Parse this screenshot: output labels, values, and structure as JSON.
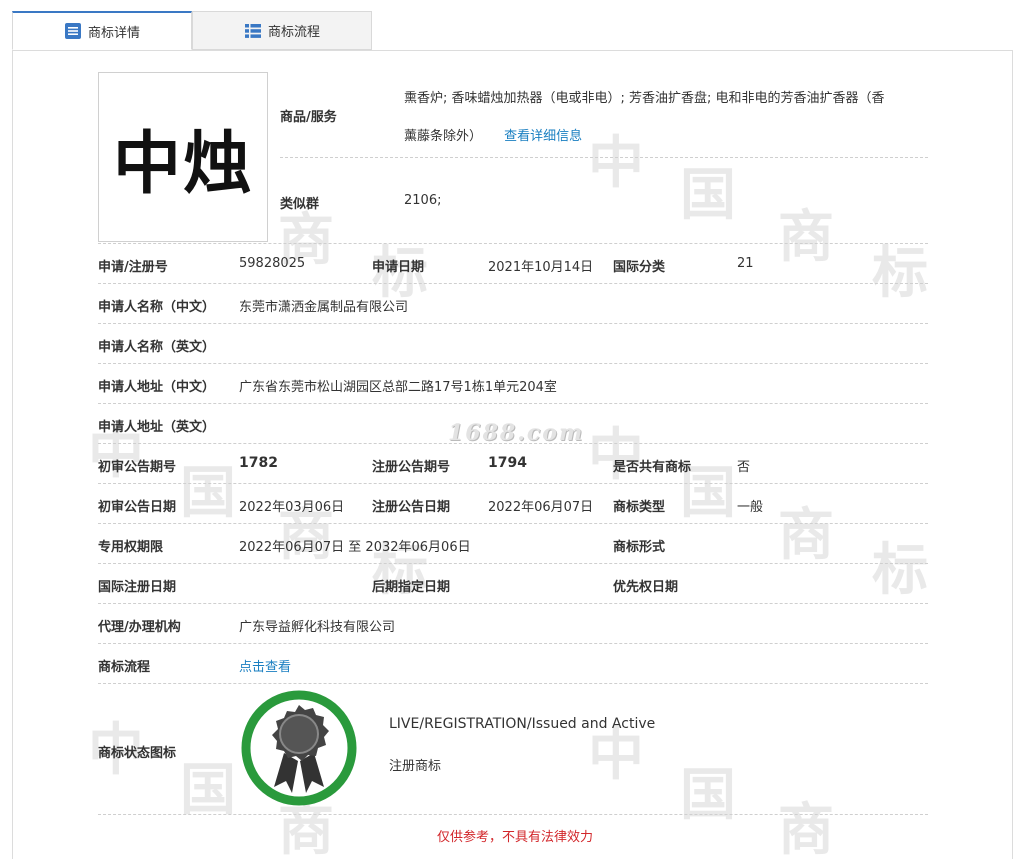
{
  "tabs": {
    "detail_label": "商标详情",
    "flow_label": "商标流程"
  },
  "trademark": {
    "image_text": "中烛",
    "goods_label": "商品/服务",
    "goods_line1": "熏香炉; 香味蜡烛加热器（电或非电）; 芳香油扩香盘; 电和非电的芳香油扩香器（香",
    "goods_line2": "薰藤条除外）",
    "goods_link": "查看详细信息",
    "similar_label": "类似群",
    "similar_value": "2106;"
  },
  "fields": {
    "reg_no_label": "申请/注册号",
    "reg_no": "59828025",
    "apply_date_label": "申请日期",
    "apply_date": "2021年10月14日",
    "intl_class_label": "国际分类",
    "intl_class": "21",
    "applicant_cn_label": "申请人名称（中文）",
    "applicant_cn": "东莞市潇洒金属制品有限公司",
    "applicant_en_label": "申请人名称（英文）",
    "address_cn_label": "申请人地址（中文）",
    "address_cn": "广东省东莞市松山湖园区总部二路17号1栋1单元204室",
    "address_en_label": "申请人地址（英文）",
    "prelim_no_label": "初审公告期号",
    "prelim_no": "1782",
    "reg_pub_no_label": "注册公告期号",
    "reg_pub_no": "1794",
    "shared_label": "是否共有商标",
    "shared": "否",
    "prelim_date_label": "初审公告日期",
    "prelim_date": "2022年03月06日",
    "reg_pub_date_label": "注册公告日期",
    "reg_pub_date": "2022年06月07日",
    "tm_type_label": "商标类型",
    "tm_type": "一般",
    "exclusive_label": "专用权期限",
    "exclusive": "2022年06月07日 至 2032年06月06日",
    "tm_form_label": "商标形式",
    "intl_reg_date_label": "国际注册日期",
    "later_date_label": "后期指定日期",
    "priority_date_label": "优先权日期",
    "agent_label": "代理/办理机构",
    "agent": "广东导益孵化科技有限公司",
    "flow_label": "商标流程",
    "flow_link": "点击查看",
    "status_icon_label": "商标状态图标",
    "status_en": "LIVE/REGISTRATION/Issued and Active",
    "status_cn": "注册商标"
  },
  "watermark": {
    "site": "1688.com",
    "chars": [
      "中",
      "国",
      "商",
      "标"
    ]
  },
  "disclaimer": "仅供参考，不具有法律效力",
  "colors": {
    "accent": "#3a78c4",
    "link": "#1a7fc1",
    "badge_ring": "#2a9a3c",
    "disclaimer": "#d2262a"
  }
}
